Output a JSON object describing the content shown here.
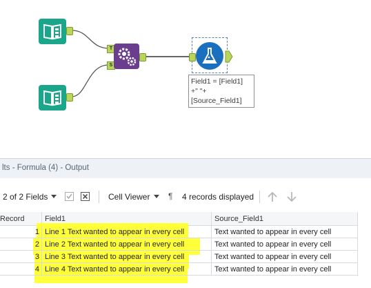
{
  "canvas": {
    "connector_labels": {
      "t": "T",
      "s": "S"
    },
    "annotation_lines": [
      "Field1 = [Field1]",
      "+\" \"+",
      "[Source_Field1]"
    ]
  },
  "results": {
    "title": "lts - Formula (4) - Output",
    "fields_label": "2 of 2 Fields",
    "cell_viewer_label": "Cell Viewer",
    "records_label": "4 records displayed",
    "columns": [
      "Record",
      "Field1",
      "Source_Field1"
    ],
    "rows": [
      {
        "record": "1",
        "field1": "Line 1 Text wanted to appear in every cell",
        "source": "Text wanted to appear in every cell"
      },
      {
        "record": "2",
        "field1": "Line 2 Text wanted to appear in every cell",
        "source": "Text wanted to appear in every cell"
      },
      {
        "record": "3",
        "field1": "Line 3 Text wanted to appear in every cell",
        "source": "Text wanted to appear in every cell"
      },
      {
        "record": "4",
        "field1": "Line 4 Text wanted to appear in every cell",
        "source": "Text wanted to appear in every cell"
      }
    ]
  },
  "colors": {
    "input_tool": "#1ba58a",
    "formula_tool": "#6a3d8f",
    "output_tool": "#1a6fbf",
    "highlight": "#ffff3a",
    "anchor": "#b9d65c"
  },
  "icons": [
    "book-icon",
    "gear-icon",
    "flask-icon",
    "dropdown-arrow-icon",
    "checkbox-icon",
    "close-box-icon",
    "pilcrow-icon",
    "arrow-up-icon",
    "arrow-down-icon"
  ]
}
